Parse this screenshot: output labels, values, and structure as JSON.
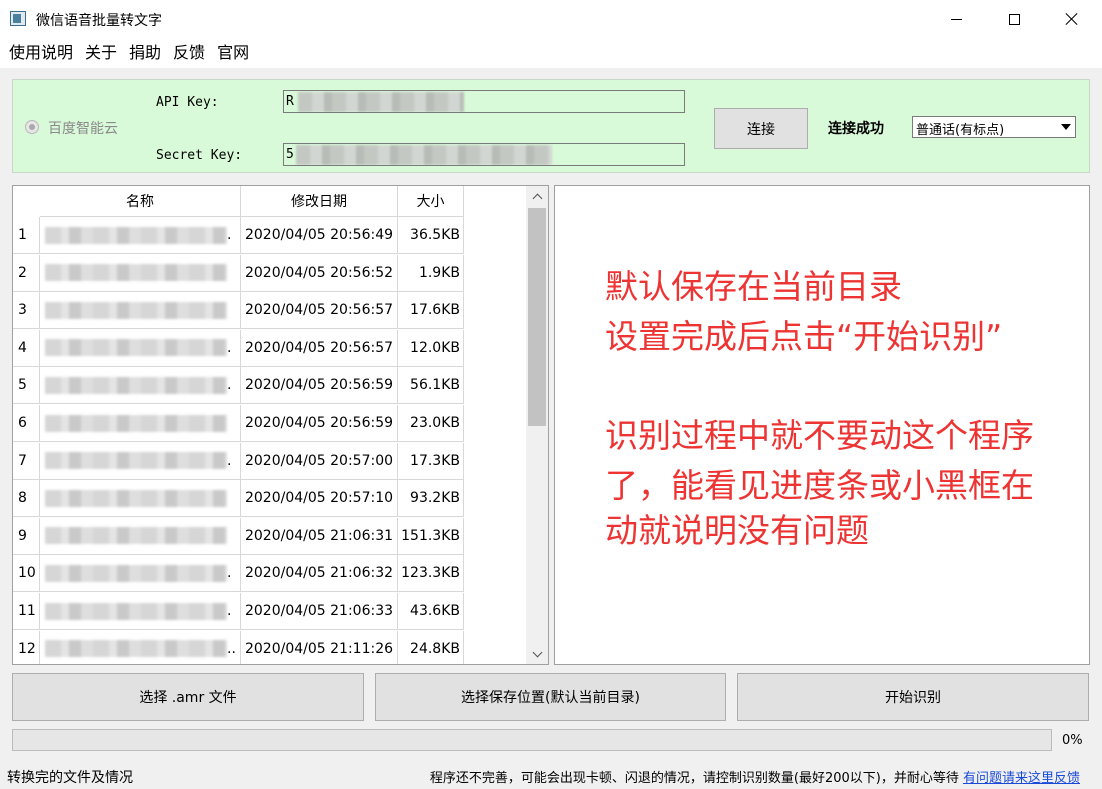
{
  "window": {
    "title": "微信语音批量转文字",
    "icon": "app-icon",
    "controls": [
      "minimize-icon",
      "maximize-icon",
      "close-icon"
    ]
  },
  "menu": {
    "items": [
      "使用说明",
      "关于",
      "捐助",
      "反馈",
      "官网"
    ]
  },
  "connection": {
    "provider_label": "百度智能云",
    "api_key_label": "API Key:",
    "api_key_value": "R                      JSE",
    "secret_key_label": "Secret Key:",
    "secret_key_value": "5",
    "connect_label": "连接",
    "status": "连接成功",
    "language": "普通话(有标点)",
    "panel_color": "#d9fad9"
  },
  "table": {
    "headers": [
      "名称",
      "修改日期",
      "大小"
    ],
    "rows": [
      {
        "index": "1",
        "name_suffix": ".",
        "date": "2020/04/05 20:56:49",
        "size": "36.5KB"
      },
      {
        "index": "2",
        "name_suffix": "",
        "date": "2020/04/05 20:56:52",
        "size": "1.9KB"
      },
      {
        "index": "3",
        "name_suffix": "",
        "date": "2020/04/05 20:56:57",
        "size": "17.6KB"
      },
      {
        "index": "4",
        "name_suffix": ".",
        "date": "2020/04/05 20:56:57",
        "size": "12.0KB"
      },
      {
        "index": "5",
        "name_suffix": ".",
        "date": "2020/04/05 20:56:59",
        "size": "56.1KB"
      },
      {
        "index": "6",
        "name_suffix": "",
        "date": "2020/04/05 20:56:59",
        "size": "23.0KB"
      },
      {
        "index": "7",
        "name_suffix": ".",
        "date": "2020/04/05 20:57:00",
        "size": "17.3KB"
      },
      {
        "index": "8",
        "name_suffix": "",
        "date": "2020/04/05 20:57:10",
        "size": "93.2KB"
      },
      {
        "index": "9",
        "name_suffix": "",
        "date": "2020/04/05 21:06:31",
        "size": "151.3KB"
      },
      {
        "index": "10",
        "name_suffix": ".",
        "date": "2020/04/05 21:06:32",
        "size": "123.3KB"
      },
      {
        "index": "11",
        "name_suffix": ".",
        "date": "2020/04/05 21:06:33",
        "size": "43.6KB"
      },
      {
        "index": "12",
        "name_suffix": "..",
        "date": "2020/04/05 21:11:26",
        "size": "24.8KB"
      }
    ]
  },
  "log": {
    "color": "#ee3333",
    "lines": [
      "默认保存在当前目录",
      "设置完成后点击“开始识别”",
      "",
      "识别过程中就不要动这个程序",
      "了，能看见进度条或小黑框在",
      "动就说明没有问题"
    ]
  },
  "actions": {
    "select_amr": "选择 .amr 文件",
    "select_save": "选择保存位置(默认当前目录)",
    "start": "开始识别"
  },
  "progress": {
    "value": 0,
    "label": "0%"
  },
  "statusbar": {
    "left": "转换完的文件及情况",
    "notice": "程序还不完善，可能会出现卡顿、闪退的情况，请控制识别数量(最好200以下)，并耐心等待 ",
    "feedback_link": "有问题请来这里反馈"
  }
}
